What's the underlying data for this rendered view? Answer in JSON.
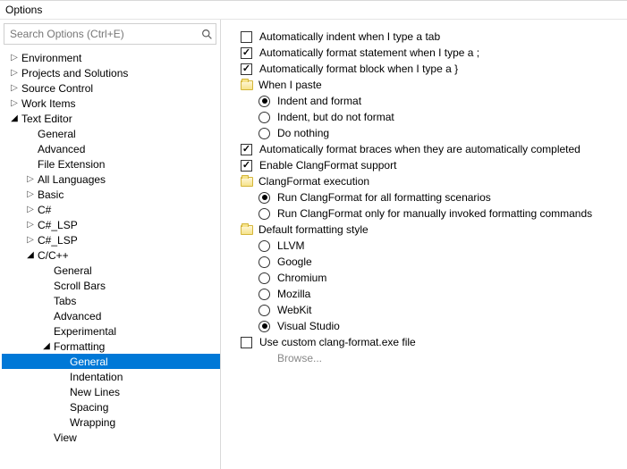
{
  "window": {
    "title": "Options"
  },
  "search": {
    "placeholder": "Search Options (Ctrl+E)"
  },
  "tree": [
    {
      "depth": 0,
      "twisty": "right",
      "label": "Environment"
    },
    {
      "depth": 0,
      "twisty": "right",
      "label": "Projects and Solutions"
    },
    {
      "depth": 0,
      "twisty": "right",
      "label": "Source Control"
    },
    {
      "depth": 0,
      "twisty": "right",
      "label": "Work Items"
    },
    {
      "depth": 0,
      "twisty": "down",
      "label": "Text Editor"
    },
    {
      "depth": 1,
      "twisty": "none",
      "label": "General"
    },
    {
      "depth": 1,
      "twisty": "none",
      "label": "Advanced"
    },
    {
      "depth": 1,
      "twisty": "none",
      "label": "File Extension"
    },
    {
      "depth": 1,
      "twisty": "right",
      "label": "All Languages"
    },
    {
      "depth": 1,
      "twisty": "right",
      "label": "Basic"
    },
    {
      "depth": 1,
      "twisty": "right",
      "label": "C#"
    },
    {
      "depth": 1,
      "twisty": "right",
      "label": "C#_LSP"
    },
    {
      "depth": 1,
      "twisty": "right",
      "label": "C#_LSP"
    },
    {
      "depth": 1,
      "twisty": "down",
      "label": "C/C++"
    },
    {
      "depth": 2,
      "twisty": "none",
      "label": "General"
    },
    {
      "depth": 2,
      "twisty": "none",
      "label": "Scroll Bars"
    },
    {
      "depth": 2,
      "twisty": "none",
      "label": "Tabs"
    },
    {
      "depth": 2,
      "twisty": "none",
      "label": "Advanced"
    },
    {
      "depth": 2,
      "twisty": "none",
      "label": "Experimental"
    },
    {
      "depth": 2,
      "twisty": "down",
      "label": "Formatting"
    },
    {
      "depth": 3,
      "twisty": "none",
      "label": "General",
      "selected": true
    },
    {
      "depth": 3,
      "twisty": "none",
      "label": "Indentation"
    },
    {
      "depth": 3,
      "twisty": "none",
      "label": "New Lines"
    },
    {
      "depth": 3,
      "twisty": "none",
      "label": "Spacing"
    },
    {
      "depth": 3,
      "twisty": "none",
      "label": "Wrapping"
    },
    {
      "depth": 2,
      "twisty": "none",
      "label": "View"
    }
  ],
  "options": [
    {
      "indent": 0,
      "type": "checkbox",
      "checked": false,
      "label": "Automatically indent when I type a tab"
    },
    {
      "indent": 0,
      "type": "checkbox",
      "checked": true,
      "label": "Automatically format statement when I type a ;"
    },
    {
      "indent": 0,
      "type": "checkbox",
      "checked": true,
      "label": "Automatically format block when I type a }"
    },
    {
      "indent": 0,
      "type": "folder",
      "label": "When I paste"
    },
    {
      "indent": 1,
      "type": "radio",
      "checked": true,
      "label": "Indent and format"
    },
    {
      "indent": 1,
      "type": "radio",
      "checked": false,
      "label": "Indent, but do not format"
    },
    {
      "indent": 1,
      "type": "radio",
      "checked": false,
      "label": "Do nothing"
    },
    {
      "indent": 0,
      "type": "checkbox",
      "checked": true,
      "label": "Automatically format braces when they are automatically completed"
    },
    {
      "indent": 0,
      "type": "checkbox",
      "checked": true,
      "label": "Enable ClangFormat support"
    },
    {
      "indent": 0,
      "type": "folder",
      "label": "ClangFormat execution"
    },
    {
      "indent": 1,
      "type": "radio",
      "checked": true,
      "label": "Run ClangFormat for all formatting scenarios"
    },
    {
      "indent": 1,
      "type": "radio",
      "checked": false,
      "label": "Run ClangFormat only for manually invoked formatting commands"
    },
    {
      "indent": 0,
      "type": "folder",
      "label": "Default formatting style"
    },
    {
      "indent": 1,
      "type": "radio",
      "checked": false,
      "label": "LLVM"
    },
    {
      "indent": 1,
      "type": "radio",
      "checked": false,
      "label": "Google"
    },
    {
      "indent": 1,
      "type": "radio",
      "checked": false,
      "label": "Chromium"
    },
    {
      "indent": 1,
      "type": "radio",
      "checked": false,
      "label": "Mozilla"
    },
    {
      "indent": 1,
      "type": "radio",
      "checked": false,
      "label": "WebKit"
    },
    {
      "indent": 1,
      "type": "radio",
      "checked": true,
      "label": "Visual Studio"
    },
    {
      "indent": 0,
      "type": "checkbox",
      "checked": false,
      "label": "Use custom clang-format.exe file"
    },
    {
      "indent": 1,
      "type": "browse",
      "label": "Browse..."
    }
  ]
}
